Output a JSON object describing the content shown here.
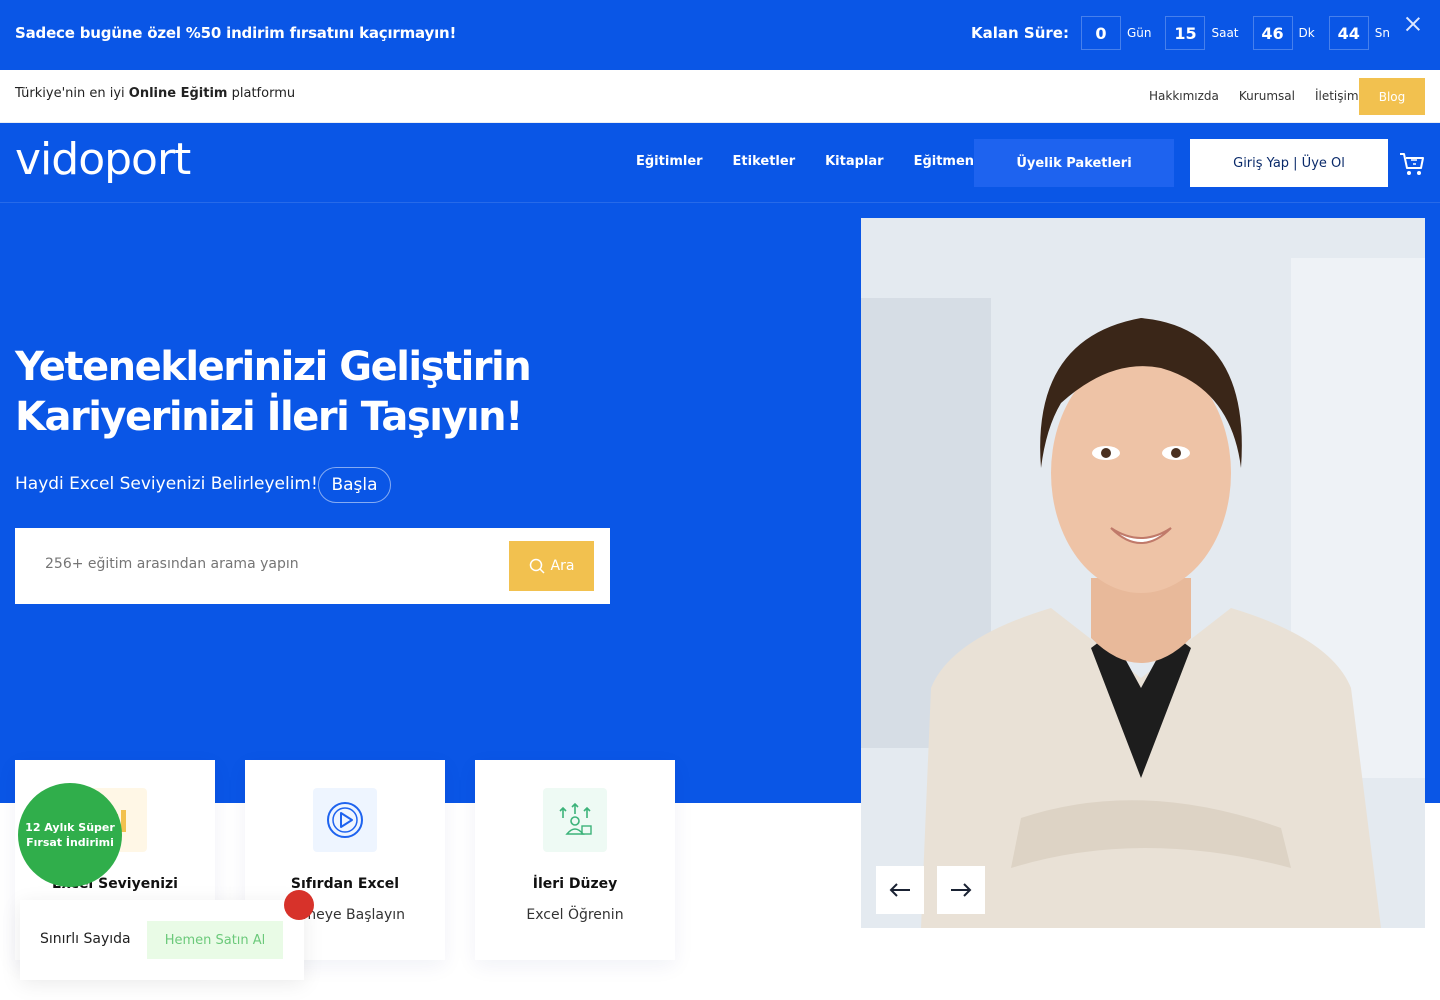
{
  "promo": {
    "text": "Sadece bugüne özel %50 indirim fırsatını kaçırmayın!",
    "countdown_label": "Kalan Süre:",
    "days": "0",
    "days_unit": "Gün",
    "hours": "15",
    "hours_unit": "Saat",
    "minutes": "46",
    "minutes_unit": "Dk",
    "seconds": "44",
    "seconds_unit": "Sn"
  },
  "topbar": {
    "tagline_pre": "Türkiye'nin en iyi ",
    "tagline_bold": "Online Eğitim",
    "tagline_post": " platformu",
    "links": [
      "Hakkımızda",
      "Kurumsal",
      "İletişim"
    ],
    "blog": "Blog"
  },
  "header": {
    "logo": "vidoport",
    "nav": [
      "Eğitimler",
      "Etiketler",
      "Kitaplar",
      "Eğitmenler"
    ],
    "membership": "Üyelik Paketleri",
    "login": "Giriş Yap | Üye Ol"
  },
  "hero": {
    "headline_1": "Yeteneklerinizi Geliştirin",
    "headline_2": "Kariyerinizi İleri Taşıyın!",
    "excel_text": "Haydi Excel Seviyenizi Belirleyelim!",
    "start": "Başla",
    "search_placeholder": "256+ eğitim arasından arama yapın",
    "search_button": "Ara"
  },
  "cards": [
    {
      "title": "Excel Seviyenizi",
      "subtitle": ""
    },
    {
      "title": "Sıfırdan Excel",
      "subtitle": "enmeye Başlayın"
    },
    {
      "title": "İleri Düzey",
      "subtitle": "Excel Öğrenin"
    }
  ],
  "offer": {
    "badge_1": "12 Aylık Süper",
    "badge_2": "Fırsat İndirimi",
    "limited": "Sınırlı Sayıda",
    "buy": "Hemen Satın Al"
  },
  "colors": {
    "brand_blue": "#0a56e6",
    "accent_yellow": "#f2c14f",
    "green": "#30ae4b"
  },
  "icons": [
    "close-icon",
    "cart-icon",
    "search-icon",
    "arrow-left-icon",
    "arrow-right-icon",
    "play-icon",
    "growth-icon",
    "chart-icon"
  ]
}
